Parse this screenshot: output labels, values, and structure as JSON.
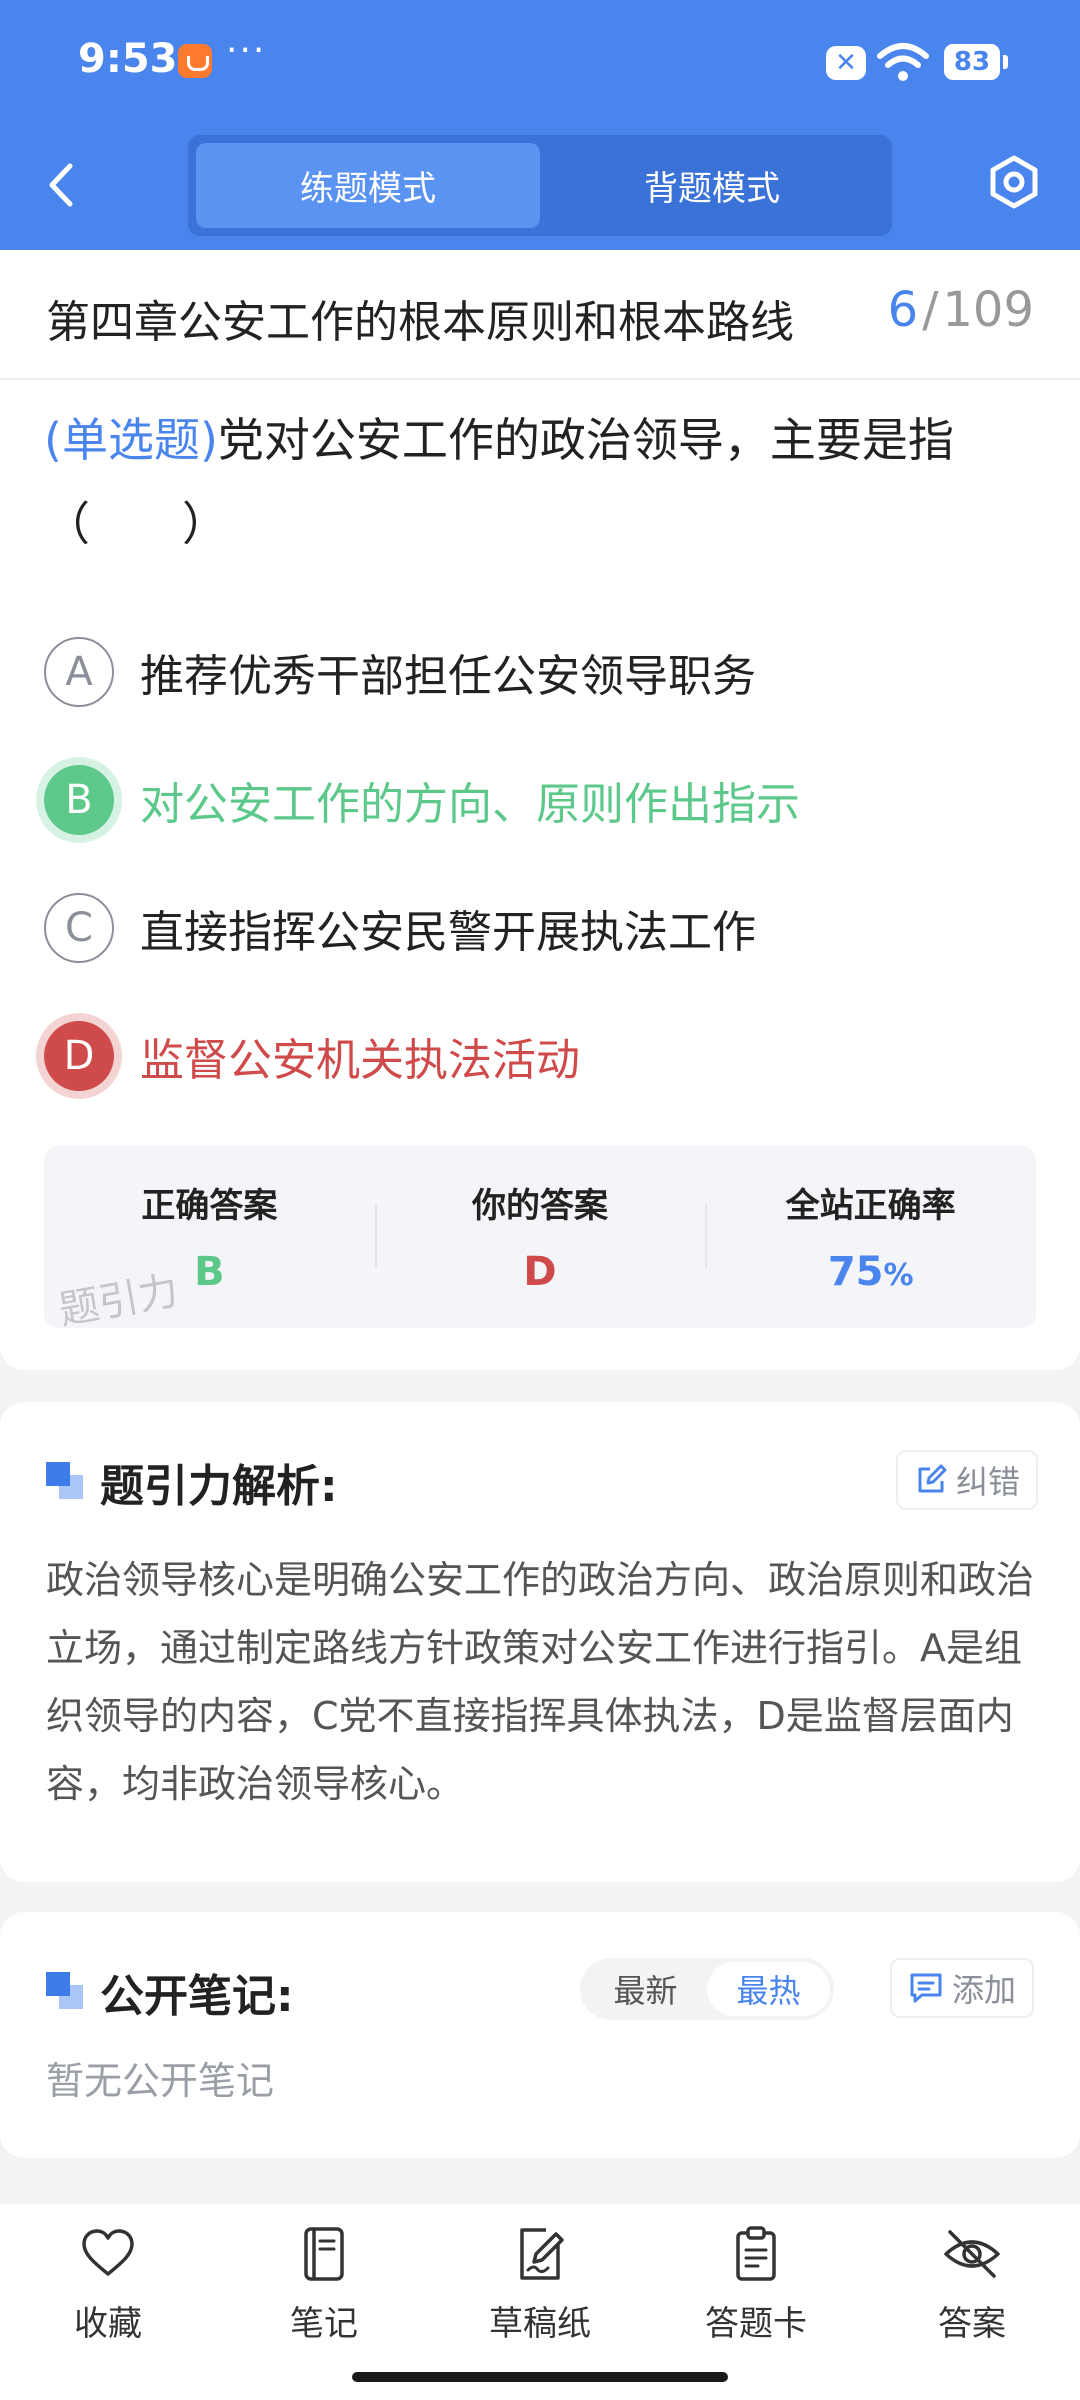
{
  "status_bar": {
    "time": "9:53",
    "more": "···",
    "battery": "83"
  },
  "header": {
    "tabs": [
      {
        "label": "练题模式",
        "active": true
      },
      {
        "label": "背题模式",
        "active": false
      }
    ]
  },
  "chapter": {
    "title": "第四章公安工作的根本原则和根本路线",
    "current": "6",
    "separator": "/",
    "total": "109"
  },
  "question": {
    "type": "(单选题)",
    "text": "党对公安工作的政治领导，主要是指（　　）",
    "options": [
      {
        "letter": "A",
        "text": "推荐优秀干部担任公安领导职务",
        "state": "normal"
      },
      {
        "letter": "B",
        "text": "对公安工作的方向、原则作出指示",
        "state": "correct"
      },
      {
        "letter": "C",
        "text": "直接指挥公安民警开展执法工作",
        "state": "normal"
      },
      {
        "letter": "D",
        "text": "监督公安机关执法活动",
        "state": "wrong"
      }
    ]
  },
  "stats": {
    "correct_label": "正确答案",
    "correct_value": "B",
    "yours_label": "你的答案",
    "yours_value": "D",
    "rate_label": "全站正确率",
    "rate_value": "75",
    "rate_unit": "%",
    "watermark": "题引力"
  },
  "analysis": {
    "title": "题引力解析:",
    "report_label": "纠错",
    "text": "政治领导核心是明确公安工作的政治方向、政治原则和政治立场，通过制定路线方针政策对公安工作进行指引。A是组织领导的内容，C党不直接指挥具体执法，D是监督层面内容，均非政治领导核心。"
  },
  "notes": {
    "title": "公开笔记:",
    "sort_newest": "最新",
    "sort_hottest": "最热",
    "add_label": "添加",
    "empty_text": "暂无公开笔记"
  },
  "bottom_nav": [
    "收藏",
    "笔记",
    "草稿纸",
    "答题卡",
    "答案"
  ],
  "colors": {
    "accent": "#4a85ee",
    "correct": "#5cc98a",
    "wrong": "#cf4a4a"
  }
}
